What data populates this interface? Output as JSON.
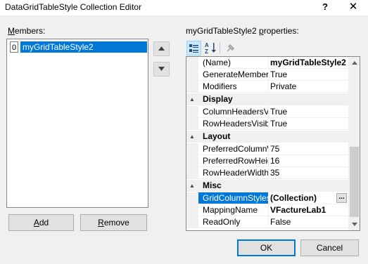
{
  "window": {
    "title": "DataGridTableStyle Collection Editor",
    "help_glyph": "?",
    "close_glyph": "✕"
  },
  "members": {
    "label_mnemonic": "M",
    "label_rest": "embers:",
    "items": [
      {
        "index": "0",
        "name": "myGridTableStyle2",
        "selected": true
      }
    ],
    "move_up_icon": "up-arrow-icon",
    "move_down_icon": "down-arrow-icon"
  },
  "buttons": {
    "add_mnemonic": "A",
    "add_rest": "dd",
    "remove_mnemonic": "R",
    "remove_rest": "emove",
    "ok": "OK",
    "cancel": "Cancel"
  },
  "properties": {
    "label_start": "myGridTableStyle2 ",
    "label_mnemonic": "p",
    "label_end": "roperties:",
    "toolbar_icons": [
      "categorized-icon",
      "alphabetical-icon",
      "property-pages-icon"
    ],
    "rows": [
      {
        "name": "(Name)",
        "value": "myGridTableStyle2"
      },
      {
        "name": "GenerateMember",
        "value": "True"
      },
      {
        "name": "Modifiers",
        "value": "Private"
      }
    ],
    "display_category": "Display",
    "display_rows": [
      {
        "name": "ColumnHeadersVisible",
        "value": "True"
      },
      {
        "name": "RowHeadersVisible",
        "value": "True"
      }
    ],
    "layout_category": "Layout",
    "layout_rows": [
      {
        "name": "PreferredColumnWidth",
        "value": "75"
      },
      {
        "name": "PreferredRowHeight",
        "value": "16"
      },
      {
        "name": "RowHeaderWidth",
        "value": "35"
      }
    ],
    "misc_category": "Misc",
    "misc_rows": [
      {
        "name": "GridColumnStyles",
        "value": "(Collection)",
        "ellipsis": "..."
      },
      {
        "name": "MappingName",
        "value": "VFactureLab1"
      },
      {
        "name": "ReadOnly",
        "value": "False"
      }
    ],
    "collapse_glyph": "▲"
  },
  "colors": {
    "selection": "#0078d7",
    "dialog_bg": "#f0f0f0"
  }
}
